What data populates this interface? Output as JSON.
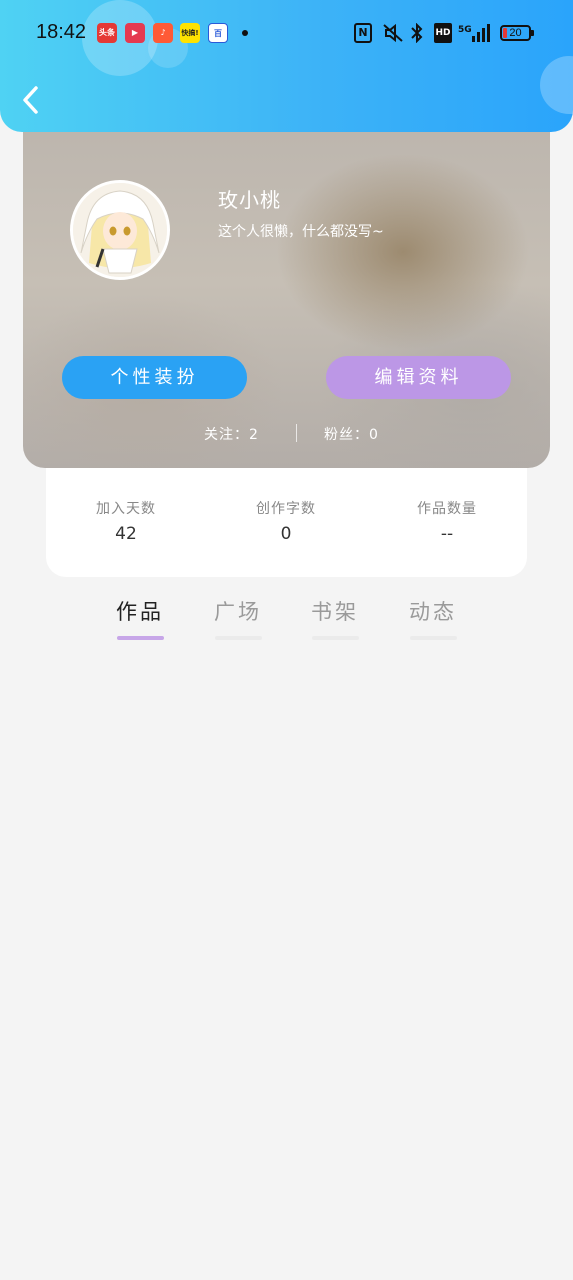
{
  "status_bar": {
    "time": "18:42",
    "notification_icons": [
      "头条",
      "▶",
      "♪",
      "快搞!",
      "百"
    ],
    "signal_label": "5G",
    "battery": "20"
  },
  "profile": {
    "nickname": "玫小桃",
    "bio": "这个人很懒，什么都没写~",
    "buttons": {
      "dress_up": "个性装扮",
      "edit_profile": "编辑资料"
    },
    "following": "关注：2",
    "followers": "粉丝：0"
  },
  "stats": [
    {
      "label": "加入天数",
      "value": "42"
    },
    {
      "label": "创作字数",
      "value": "0"
    },
    {
      "label": "作品数量",
      "value": "--"
    }
  ],
  "tabs": [
    {
      "label": "作品",
      "active": true
    },
    {
      "label": "广场",
      "active": false
    },
    {
      "label": "书架",
      "active": false
    },
    {
      "label": "动态",
      "active": false
    }
  ],
  "colors": {
    "header_start": "#4fd2f3",
    "header_end": "#2aa4fb",
    "dress_up_button": "#2aa2f4",
    "edit_button": "#bc97e6",
    "tab_indicator_active": "#c7a6e8"
  }
}
